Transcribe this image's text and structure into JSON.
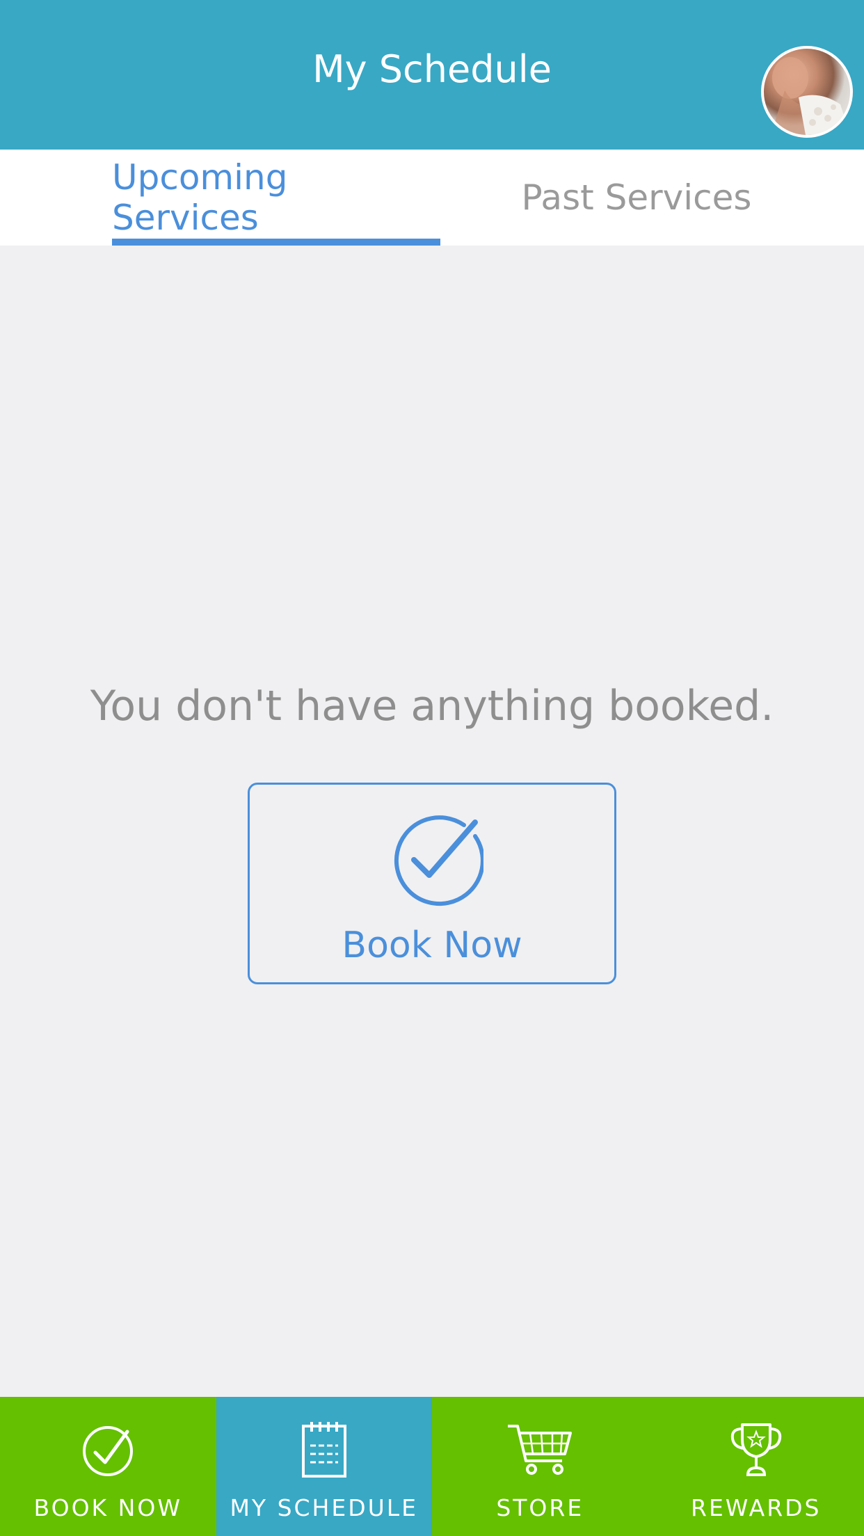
{
  "header": {
    "title": "My Schedule",
    "avatar_icon": "user-avatar-photo"
  },
  "tabs": [
    {
      "label": "Upcoming Services",
      "active": true
    },
    {
      "label": "Past Services",
      "active": false
    }
  ],
  "main": {
    "empty_message": "You don't have anything booked.",
    "book_button": {
      "label": "Book Now",
      "icon": "check-circle-icon"
    }
  },
  "bottom_nav": {
    "items": [
      {
        "label": "BOOK NOW",
        "icon": "check-circle-icon",
        "active": false
      },
      {
        "label": "MY SCHEDULE",
        "icon": "calendar-icon",
        "active": true
      },
      {
        "label": "STORE",
        "icon": "cart-icon",
        "active": false
      },
      {
        "label": "REWARDS",
        "icon": "trophy-icon",
        "active": false
      }
    ]
  },
  "colors": {
    "header_bg": "#38a8c5",
    "accent_blue": "#4a8fdb",
    "nav_green": "#64c000",
    "background": "#f0f0f2"
  }
}
